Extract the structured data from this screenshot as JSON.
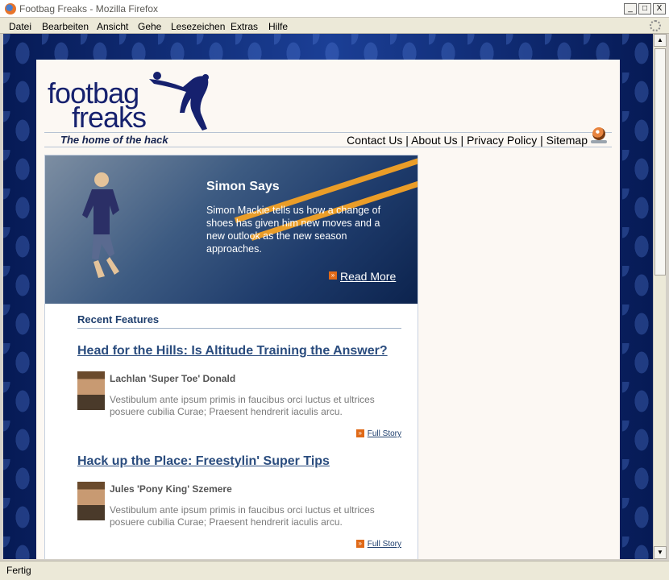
{
  "window": {
    "title": "Footbag Freaks - Mozilla Firefox",
    "controls": {
      "minimize": "_",
      "maximize": "□",
      "close": "X"
    }
  },
  "menubar": {
    "items": [
      "Datei",
      "Bearbeiten",
      "Ansicht",
      "Gehe",
      "Lesezeichen",
      "Extras",
      "Hilfe"
    ]
  },
  "site": {
    "logo_line1": "footbag",
    "logo_line2": "freaks",
    "tagline": "The home of the hack",
    "nav": [
      "Contact Us",
      "About Us",
      "Privacy Policy",
      "Sitemap"
    ],
    "nav_separator": "|"
  },
  "hero": {
    "title": "Simon Says",
    "text": "Simon Mackie tells us how a change of shoes has given him new moves and a new outlook as the new season approaches.",
    "read_more": "Read More"
  },
  "features": {
    "title": "Recent Features",
    "articles": [
      {
        "headline": "Head for the Hills: Is Altitude Training the Answer?",
        "author": "Lachlan 'Super Toe' Donald",
        "blurb": "Vestibulum ante ipsum primis in faucibus orci luctus et ultrices posuere cubilia Curae; Praesent hendrerit iaculis arcu.",
        "link": "Full Story"
      },
      {
        "headline": "Hack up the Place: Freestylin' Super Tips",
        "author": "Jules 'Pony King' Szemere",
        "blurb": "Vestibulum ante ipsum primis in faucibus orci luctus et ultrices posuere cubilia Curae; Praesent hendrerit iaculis arcu.",
        "link": "Full Story"
      }
    ]
  },
  "statusbar": {
    "text": "Fertig"
  },
  "colors": {
    "nav_blue": "#1f3f6e",
    "accent_orange": "#e06a18",
    "page_bg": "#fcf8f3"
  }
}
